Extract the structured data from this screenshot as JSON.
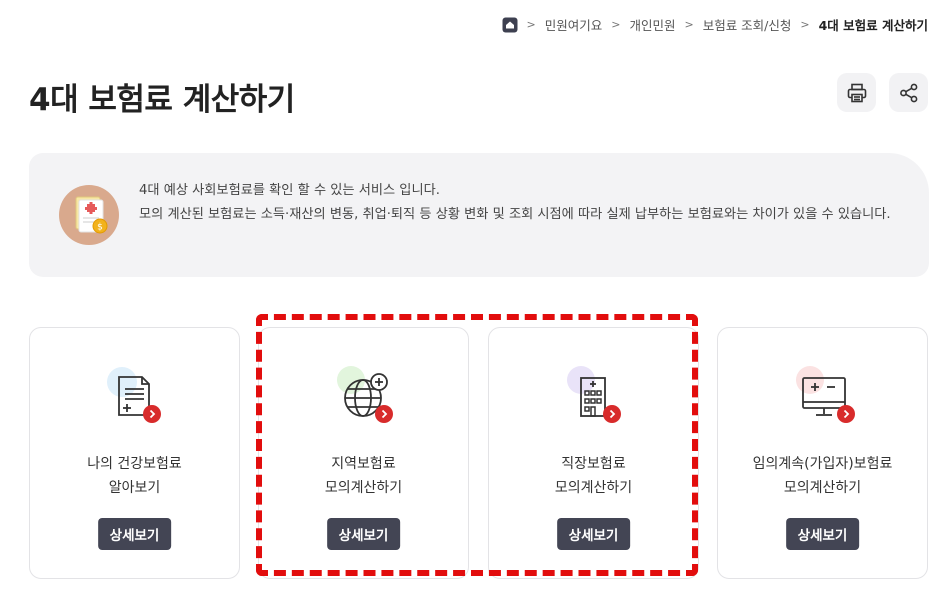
{
  "breadcrumb": {
    "items": [
      "민원여기요",
      "개인민원",
      "보험료 조회/신청",
      "4대 보험료 계산하기"
    ]
  },
  "page": {
    "title": "4대 보험료 계산하기"
  },
  "info": {
    "line1": "4대 예상 사회보험료를 확인 할 수 있는 서비스 입니다.",
    "line2": "모의 계산된 보험료는 소득·재산의 변동, 취업·퇴직 등 상황 변화 및 조회 시점에 따라 실제 납부하는 보험료와는 차이가 있을 수 있습니다."
  },
  "cards": [
    {
      "line1": "나의 건강보험료",
      "line2": "알아보기",
      "button": "상세보기",
      "icon": "document-icon"
    },
    {
      "line1": "지역보험료",
      "line2": "모의계산하기",
      "button": "상세보기",
      "icon": "globe-icon"
    },
    {
      "line1": "직장보험료",
      "line2": "모의계산하기",
      "button": "상세보기",
      "icon": "building-icon"
    },
    {
      "line1": "임의계속(가입자)보험료",
      "line2": "모의계산하기",
      "button": "상세보기",
      "icon": "calculator-monitor-icon"
    }
  ],
  "colors": {
    "accent_red": "#d82b2b",
    "button_dark": "#434554",
    "highlight_red": "#e20d0d"
  }
}
